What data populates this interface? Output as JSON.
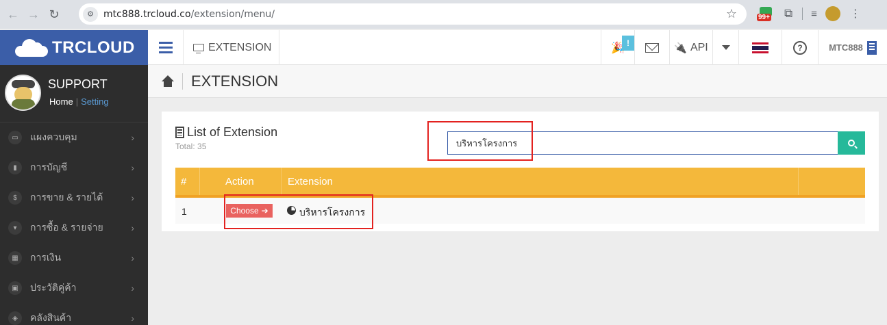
{
  "browser": {
    "url_host": "mtc888.trcloud.co",
    "url_path": "/extension/menu/",
    "ext_badge": "99+"
  },
  "header": {
    "logo": "TRCLOUD",
    "page_tab": "EXTENSION",
    "party_badge": "!",
    "api_label": "API",
    "user_label": "MTC888"
  },
  "sidebar": {
    "user_name": "SUPPORT",
    "home_link": "Home",
    "setting_link": "Setting",
    "items": [
      {
        "label": "แผงควบคุม",
        "icon": "monitor-icon"
      },
      {
        "label": "การบัญชี",
        "icon": "book-icon"
      },
      {
        "label": "การขาย & รายได้",
        "icon": "dollar-icon"
      },
      {
        "label": "การซื้อ & รายจ่าย",
        "icon": "cart-icon"
      },
      {
        "label": "การเงิน",
        "icon": "calendar-icon"
      },
      {
        "label": "ประวัติคู่ค้า",
        "icon": "contact-icon"
      },
      {
        "label": "คลังสินค้า",
        "icon": "boxes-icon"
      }
    ]
  },
  "breadcrumb": {
    "title": "EXTENSION"
  },
  "panel": {
    "title": "List of Extension",
    "total": "Total: 35",
    "search_value": "บริหารโครงการ"
  },
  "table": {
    "headers": [
      "#",
      "Action",
      "Extension"
    ],
    "rows": [
      {
        "num": "1",
        "action": "Choose",
        "extension": "บริหารโครงการ"
      }
    ]
  },
  "colors": {
    "brand": "#3b5ea8",
    "table_header": "#f4b83b",
    "choose_button": "#e9625f",
    "search_button": "#26b99a",
    "highlight": "#e3221f"
  }
}
